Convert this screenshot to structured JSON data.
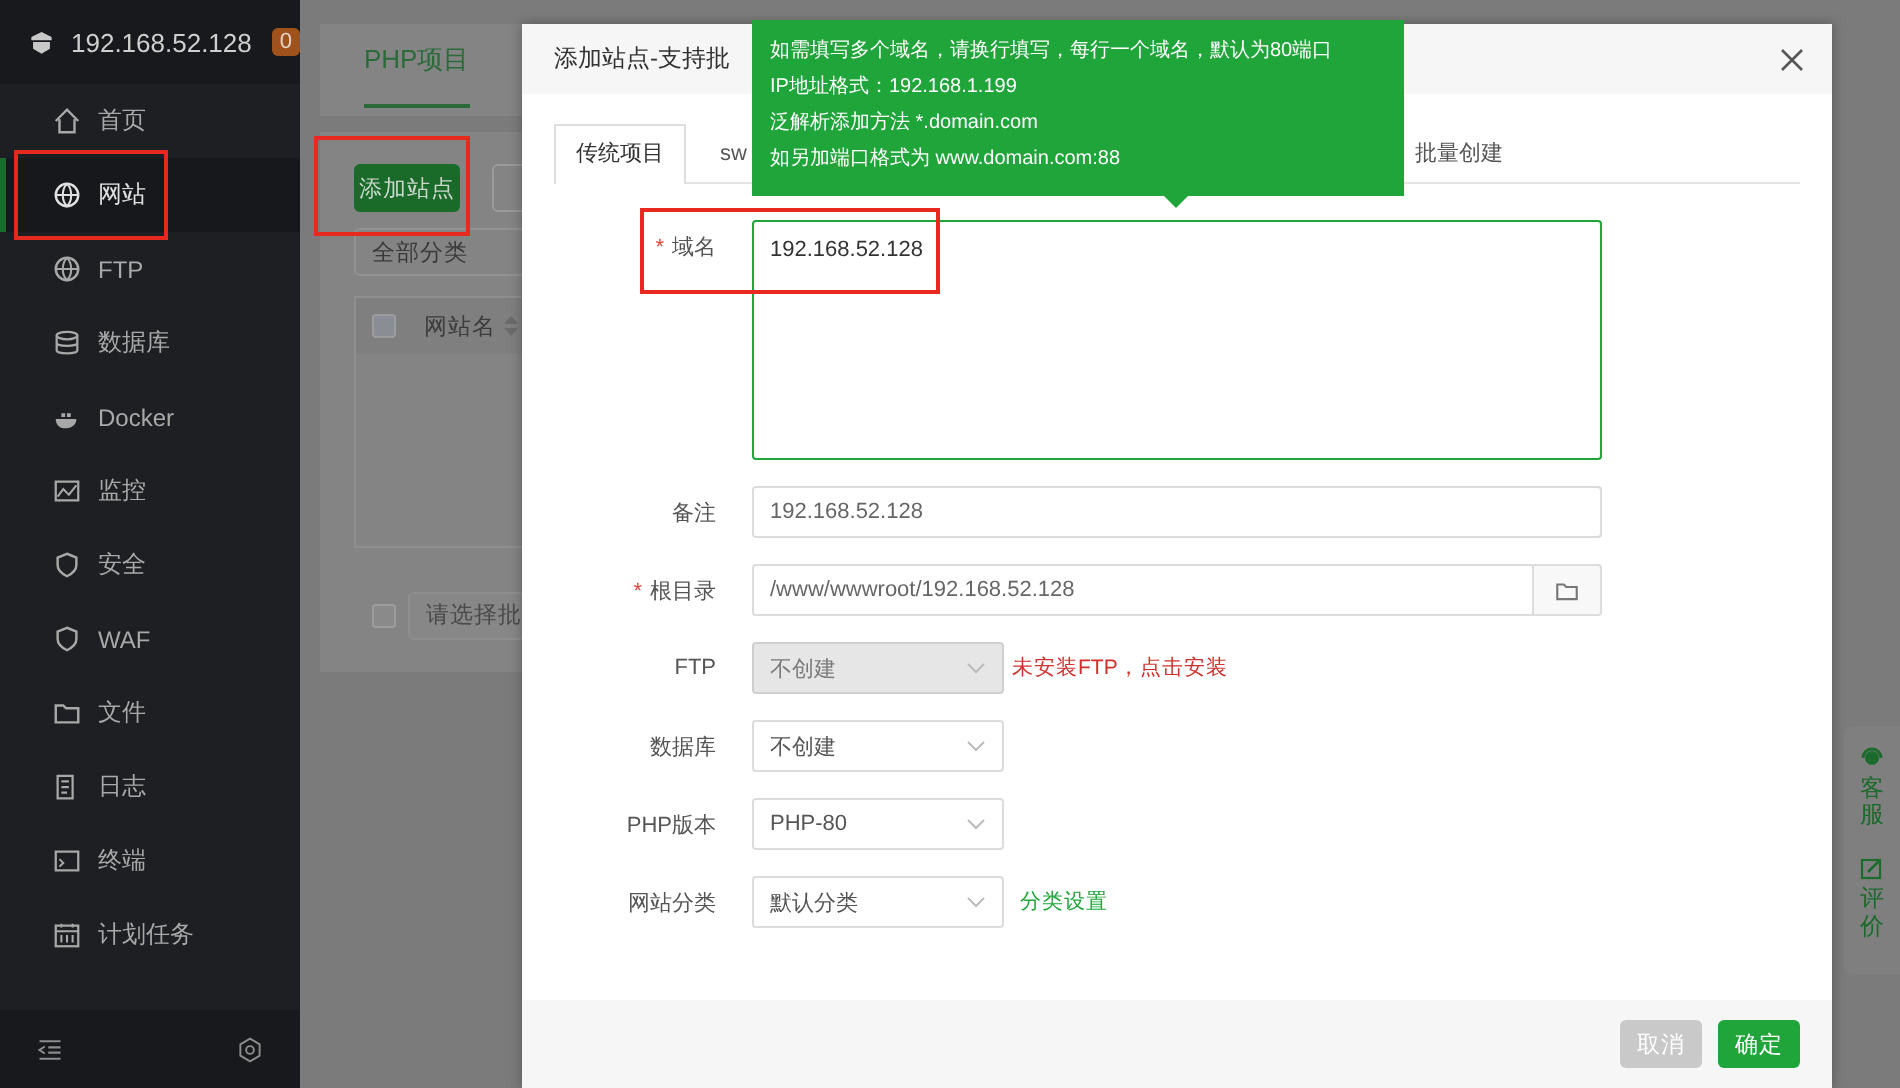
{
  "sidebar": {
    "host": "192.168.52.128",
    "badge": "0",
    "items": [
      {
        "label": "首页",
        "selected": false
      },
      {
        "label": "网站",
        "selected": true,
        "highlighted": true
      },
      {
        "label": "FTP",
        "selected": false
      },
      {
        "label": "数据库",
        "selected": false
      },
      {
        "label": "Docker",
        "selected": false
      },
      {
        "label": "监控",
        "selected": false
      },
      {
        "label": "安全",
        "selected": false
      },
      {
        "label": "WAF",
        "selected": false
      },
      {
        "label": "文件",
        "selected": false
      },
      {
        "label": "日志",
        "selected": false
      },
      {
        "label": "终端",
        "selected": false
      },
      {
        "label": "计划任务",
        "selected": false
      }
    ]
  },
  "page": {
    "tabs": [
      {
        "label": "PHP项目",
        "selected": true
      }
    ],
    "add_button": {
      "label": "添加站点",
      "highlighted": true
    },
    "category_select": "全部分类",
    "table": {
      "checked": false,
      "columns": [
        "网站名"
      ]
    },
    "batch": {
      "checked": false,
      "placeholder": "请选择批"
    }
  },
  "dialog": {
    "title": "添加站点-支持批",
    "tabs": [
      {
        "label": "传统项目",
        "selected": true
      },
      {
        "label": "sw",
        "selected": false
      },
      {
        "label": "批量创建",
        "selected": false
      }
    ],
    "tooltip": [
      "如需填写多个域名，请换行填写，每行一个域名，默认为80端口",
      "IP地址格式：192.168.1.199",
      "泛解析添加方法 *.domain.com",
      "如另加端口格式为 www.domain.com:88"
    ],
    "fields": [
      {
        "kind": "textarea",
        "label": "域名",
        "required_mark": "*",
        "highlighted": true,
        "value": "192.168.52.128"
      },
      {
        "kind": "input",
        "label": "备注",
        "value": "192.168.52.128"
      },
      {
        "kind": "path",
        "label": "根目录",
        "required_mark": "*",
        "value": "/www/wwwroot/192.168.52.128"
      },
      {
        "kind": "select",
        "label": "FTP",
        "value": "不创建",
        "disabled": true,
        "note": {
          "kind": "warning",
          "text": "未安装FTP，点击安装"
        }
      },
      {
        "kind": "select",
        "label": "数据库",
        "value": "不创建",
        "disabled": false
      },
      {
        "kind": "select",
        "label": "PHP版本",
        "value": "PHP-80",
        "disabled": false
      },
      {
        "kind": "select",
        "label": "网站分类",
        "value": "默认分类",
        "disabled": false,
        "note": {
          "kind": "link",
          "text": "分类设置"
        }
      }
    ],
    "buttons": [
      {
        "label": "取消",
        "kind": "cancel"
      },
      {
        "label": "确定",
        "kind": "primary"
      }
    ]
  },
  "float_panel": [
    {
      "label": "客服",
      "kind": "support"
    },
    {
      "label": "评价",
      "kind": "review"
    }
  ]
}
